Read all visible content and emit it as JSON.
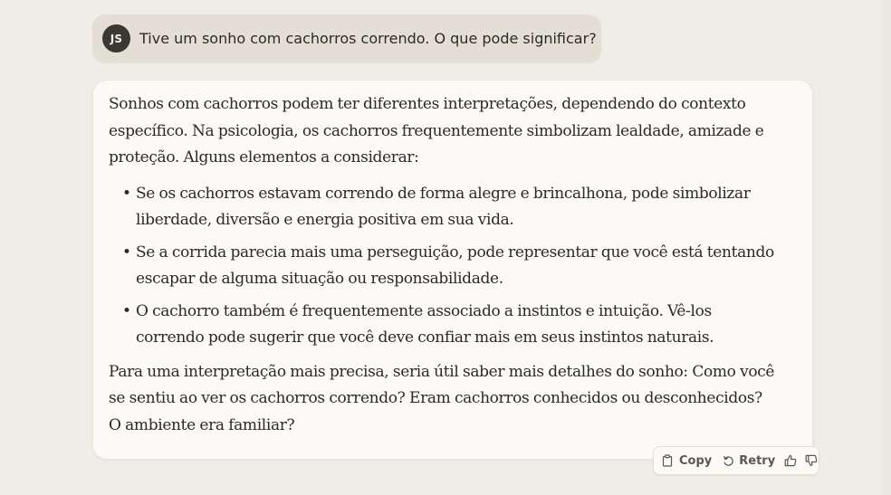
{
  "user_message": {
    "avatar_initials": "JS",
    "text": "Tive um sonho com cachorros correndo. O que pode significar?"
  },
  "assistant_message": {
    "intro": "Sonhos com cachorros podem ter diferentes interpretações, dependendo do contexto específico. Na psicologia, os cachorros frequentemente simbolizam lealdade, amizade e proteção. Alguns elementos a considerar:",
    "bullets": [
      "Se os cachorros estavam correndo de forma alegre e brincalhona, pode simbolizar liberdade, diversão e energia positiva em sua vida.",
      "Se a corrida parecia mais uma perseguição, pode representar que você está tentando escapar de alguma situação ou responsabilidade.",
      "O cachorro também é frequentemente associado a instintos e intuição. Vê-los correndo pode sugerir que você deve confiar mais em seus instintos naturais."
    ],
    "closing": "Para uma interpretação mais precisa, seria útil saber mais detalhes do sonho: Como você se sentiu ao ver os cachorros correndo? Eram cachorros conhecidos ou desconhecidos? O ambiente era familiar?"
  },
  "actions": {
    "copy_label": "Copy",
    "retry_label": "Retry",
    "icons": [
      "clipboard-icon",
      "retry-icon",
      "thumbs-up-icon",
      "thumbs-down-icon"
    ]
  },
  "colors": {
    "page_background": "#f0ede6",
    "user_bubble": "#e3dfd4",
    "assistant_bubble": "#fbfaf6",
    "avatar": "#3a3832",
    "text": "#2b2a25"
  }
}
